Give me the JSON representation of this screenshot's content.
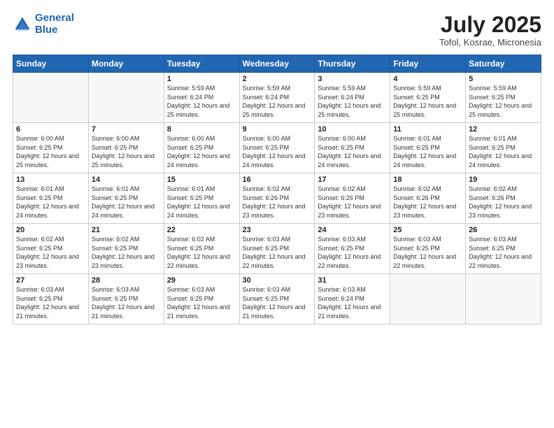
{
  "header": {
    "logo_line1": "General",
    "logo_line2": "Blue",
    "title": "July 2025",
    "subtitle": "Tofol, Kosrae, Micronesia"
  },
  "weekdays": [
    "Sunday",
    "Monday",
    "Tuesday",
    "Wednesday",
    "Thursday",
    "Friday",
    "Saturday"
  ],
  "weeks": [
    [
      {
        "day": "",
        "info": ""
      },
      {
        "day": "",
        "info": ""
      },
      {
        "day": "1",
        "info": "Sunrise: 5:59 AM\nSunset: 6:24 PM\nDaylight: 12 hours\nand 25 minutes."
      },
      {
        "day": "2",
        "info": "Sunrise: 5:59 AM\nSunset: 6:24 PM\nDaylight: 12 hours\nand 25 minutes."
      },
      {
        "day": "3",
        "info": "Sunrise: 5:59 AM\nSunset: 6:24 PM\nDaylight: 12 hours\nand 25 minutes."
      },
      {
        "day": "4",
        "info": "Sunrise: 5:59 AM\nSunset: 6:25 PM\nDaylight: 12 hours\nand 25 minutes."
      },
      {
        "day": "5",
        "info": "Sunrise: 5:59 AM\nSunset: 6:25 PM\nDaylight: 12 hours\nand 25 minutes."
      }
    ],
    [
      {
        "day": "6",
        "info": "Sunrise: 6:00 AM\nSunset: 6:25 PM\nDaylight: 12 hours\nand 25 minutes."
      },
      {
        "day": "7",
        "info": "Sunrise: 6:00 AM\nSunset: 6:25 PM\nDaylight: 12 hours\nand 25 minutes."
      },
      {
        "day": "8",
        "info": "Sunrise: 6:00 AM\nSunset: 6:25 PM\nDaylight: 12 hours\nand 24 minutes."
      },
      {
        "day": "9",
        "info": "Sunrise: 6:00 AM\nSunset: 6:25 PM\nDaylight: 12 hours\nand 24 minutes."
      },
      {
        "day": "10",
        "info": "Sunrise: 6:00 AM\nSunset: 6:25 PM\nDaylight: 12 hours\nand 24 minutes."
      },
      {
        "day": "11",
        "info": "Sunrise: 6:01 AM\nSunset: 6:25 PM\nDaylight: 12 hours\nand 24 minutes."
      },
      {
        "day": "12",
        "info": "Sunrise: 6:01 AM\nSunset: 6:25 PM\nDaylight: 12 hours\nand 24 minutes."
      }
    ],
    [
      {
        "day": "13",
        "info": "Sunrise: 6:01 AM\nSunset: 6:25 PM\nDaylight: 12 hours\nand 24 minutes."
      },
      {
        "day": "14",
        "info": "Sunrise: 6:01 AM\nSunset: 6:25 PM\nDaylight: 12 hours\nand 24 minutes."
      },
      {
        "day": "15",
        "info": "Sunrise: 6:01 AM\nSunset: 6:25 PM\nDaylight: 12 hours\nand 24 minutes."
      },
      {
        "day": "16",
        "info": "Sunrise: 6:02 AM\nSunset: 6:26 PM\nDaylight: 12 hours\nand 23 minutes."
      },
      {
        "day": "17",
        "info": "Sunrise: 6:02 AM\nSunset: 6:26 PM\nDaylight: 12 hours\nand 23 minutes."
      },
      {
        "day": "18",
        "info": "Sunrise: 6:02 AM\nSunset: 6:26 PM\nDaylight: 12 hours\nand 23 minutes."
      },
      {
        "day": "19",
        "info": "Sunrise: 6:02 AM\nSunset: 6:26 PM\nDaylight: 12 hours\nand 23 minutes."
      }
    ],
    [
      {
        "day": "20",
        "info": "Sunrise: 6:02 AM\nSunset: 6:25 PM\nDaylight: 12 hours\nand 23 minutes."
      },
      {
        "day": "21",
        "info": "Sunrise: 6:02 AM\nSunset: 6:25 PM\nDaylight: 12 hours\nand 23 minutes."
      },
      {
        "day": "22",
        "info": "Sunrise: 6:02 AM\nSunset: 6:25 PM\nDaylight: 12 hours\nand 22 minutes."
      },
      {
        "day": "23",
        "info": "Sunrise: 6:03 AM\nSunset: 6:25 PM\nDaylight: 12 hours\nand 22 minutes."
      },
      {
        "day": "24",
        "info": "Sunrise: 6:03 AM\nSunset: 6:25 PM\nDaylight: 12 hours\nand 22 minutes."
      },
      {
        "day": "25",
        "info": "Sunrise: 6:03 AM\nSunset: 6:25 PM\nDaylight: 12 hours\nand 22 minutes."
      },
      {
        "day": "26",
        "info": "Sunrise: 6:03 AM\nSunset: 6:25 PM\nDaylight: 12 hours\nand 22 minutes."
      }
    ],
    [
      {
        "day": "27",
        "info": "Sunrise: 6:03 AM\nSunset: 6:25 PM\nDaylight: 12 hours\nand 21 minutes."
      },
      {
        "day": "28",
        "info": "Sunrise: 6:03 AM\nSunset: 6:25 PM\nDaylight: 12 hours\nand 21 minutes."
      },
      {
        "day": "29",
        "info": "Sunrise: 6:03 AM\nSunset: 6:25 PM\nDaylight: 12 hours\nand 21 minutes."
      },
      {
        "day": "30",
        "info": "Sunrise: 6:03 AM\nSunset: 6:25 PM\nDaylight: 12 hours\nand 21 minutes."
      },
      {
        "day": "31",
        "info": "Sunrise: 6:03 AM\nSunset: 6:24 PM\nDaylight: 12 hours\nand 21 minutes."
      },
      {
        "day": "",
        "info": ""
      },
      {
        "day": "",
        "info": ""
      }
    ]
  ]
}
